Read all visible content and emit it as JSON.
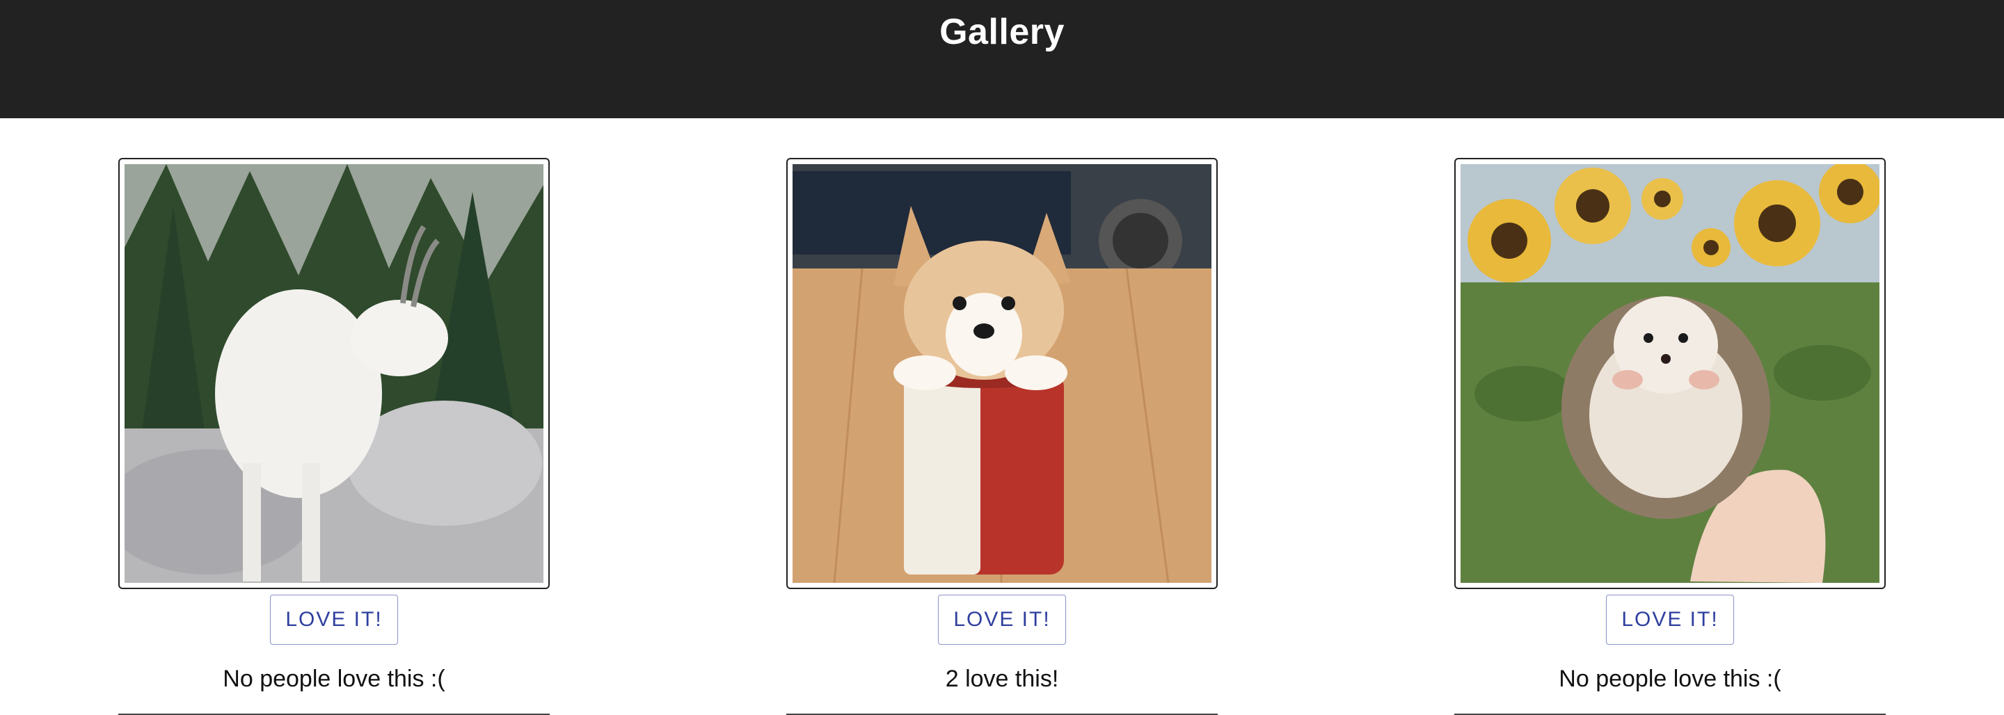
{
  "header": {
    "title": "Gallery"
  },
  "cards": [
    {
      "image_name": "mountain-goat-photo",
      "button_label": "LOVE IT!",
      "love_count_text": "No people love this :("
    },
    {
      "image_name": "corgi-puppy-in-can-photo",
      "button_label": "LOVE IT!",
      "love_count_text": "2 love this!"
    },
    {
      "image_name": "hedgehog-in-sunflowers-photo",
      "button_label": "LOVE IT!",
      "love_count_text": "No people love this :("
    }
  ],
  "colors": {
    "header_bg": "#222222",
    "button_text": "#2e3f9e",
    "button_border": "#8a93c9"
  }
}
